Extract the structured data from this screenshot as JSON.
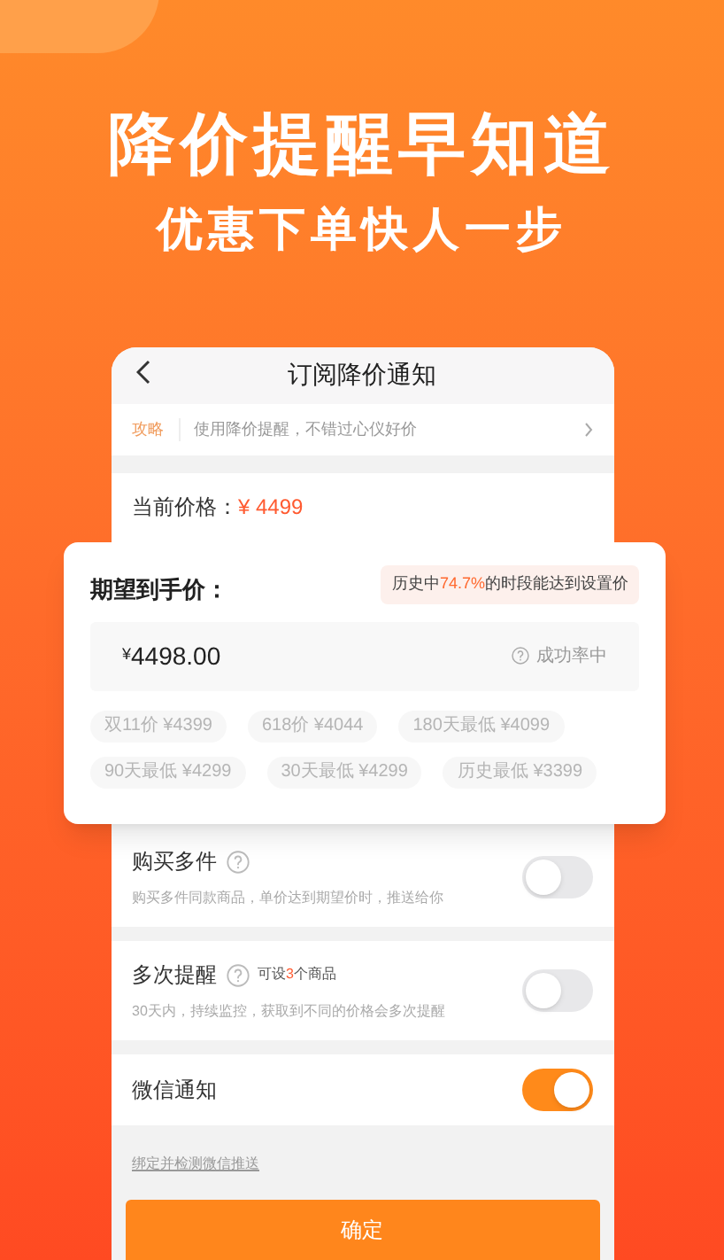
{
  "headline": "降价提醒早知道",
  "subheadline": "优惠下单快人一步",
  "screen": {
    "title": "订阅降价通知",
    "tip": {
      "tag": "攻略",
      "text": "使用降价提醒，不错过心仪好价"
    },
    "current_price": {
      "label": "当前价格：",
      "value": "¥ 4499"
    },
    "options": [
      {
        "title": "购买多件",
        "description": "购买多件同款商品，单价达到期望价时，推送给你",
        "on": false,
        "has_help": true
      },
      {
        "title": "多次提醒",
        "extra_before": "可设",
        "extra_highlight": "3",
        "extra_after": "个商品",
        "description": "30天内，持续监控，获取到不同的价格会多次提醒",
        "on": false,
        "has_help": true
      },
      {
        "title": "微信通知",
        "on": true
      }
    ],
    "link": "绑定并检测微信推送",
    "confirm": "确定"
  },
  "popup": {
    "label": "期望到手价：",
    "hint_before": "历史中",
    "hint_highlight": "74.7%",
    "hint_after": "的时段能达到设置价",
    "currency": "¥",
    "value": "4498.00",
    "rate": "成功率中",
    "chips": [
      "双11价 ¥4399",
      "618价 ¥4044",
      "180天最低 ¥4099",
      "90天最低 ¥4299",
      "30天最低 ¥4299",
      "历史最低 ¥3399"
    ]
  }
}
